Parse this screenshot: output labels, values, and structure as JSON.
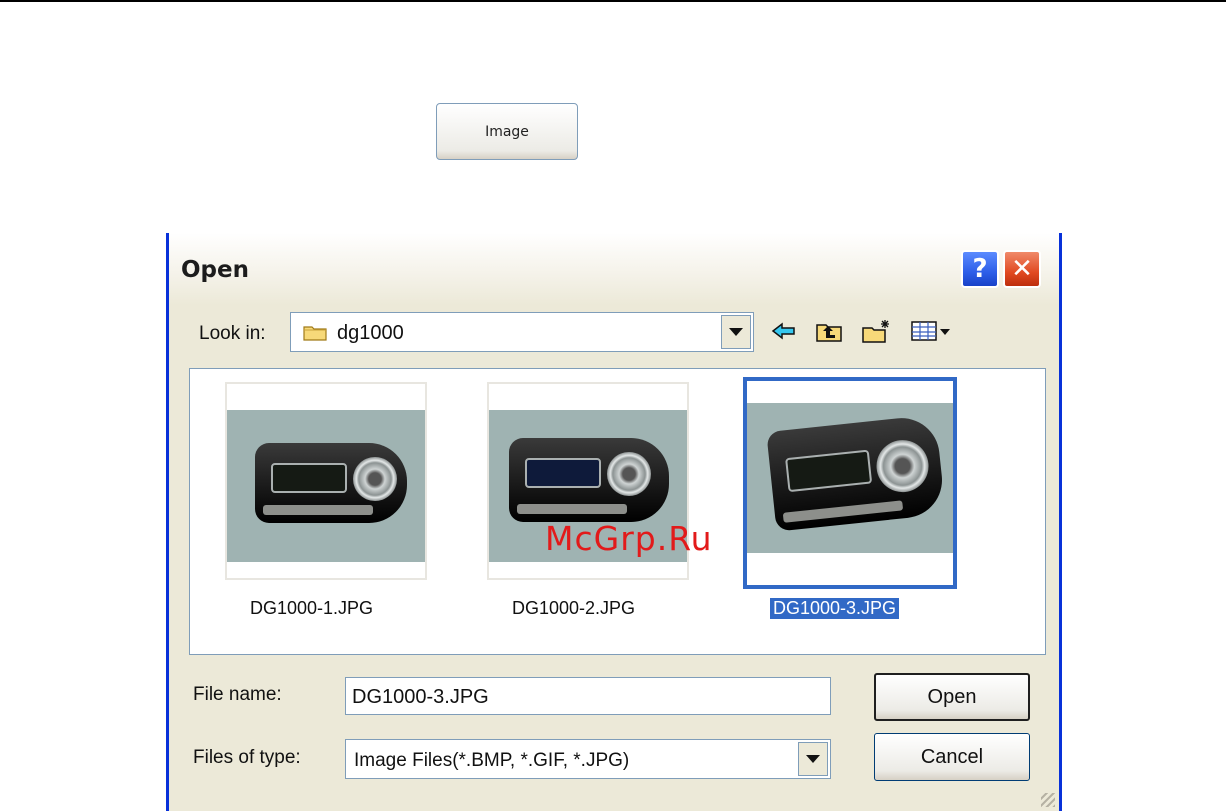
{
  "page": {
    "button_label": "Image"
  },
  "dialog": {
    "title": "Open",
    "help_label": "?",
    "close_label": "✕",
    "look_in_label": "Look in:",
    "look_in_value": "dg1000",
    "watermark": "McGrp.Ru",
    "files": [
      {
        "name": "DG1000-1.JPG",
        "selected": false
      },
      {
        "name": "DG1000-2.JPG",
        "selected": false
      },
      {
        "name": "DG1000-3.JPG",
        "selected": true
      }
    ],
    "file_name_label": "File name:",
    "file_name_value": "DG1000-3.JPG",
    "file_type_label": "Files of type:",
    "file_type_value": "Image Files(*.BMP, *.GIF, *.JPG)",
    "open_label": "Open",
    "cancel_label": "Cancel",
    "toolbar_icons": [
      "back-icon",
      "up-folder-icon",
      "new-folder-icon",
      "view-menu-icon"
    ]
  }
}
